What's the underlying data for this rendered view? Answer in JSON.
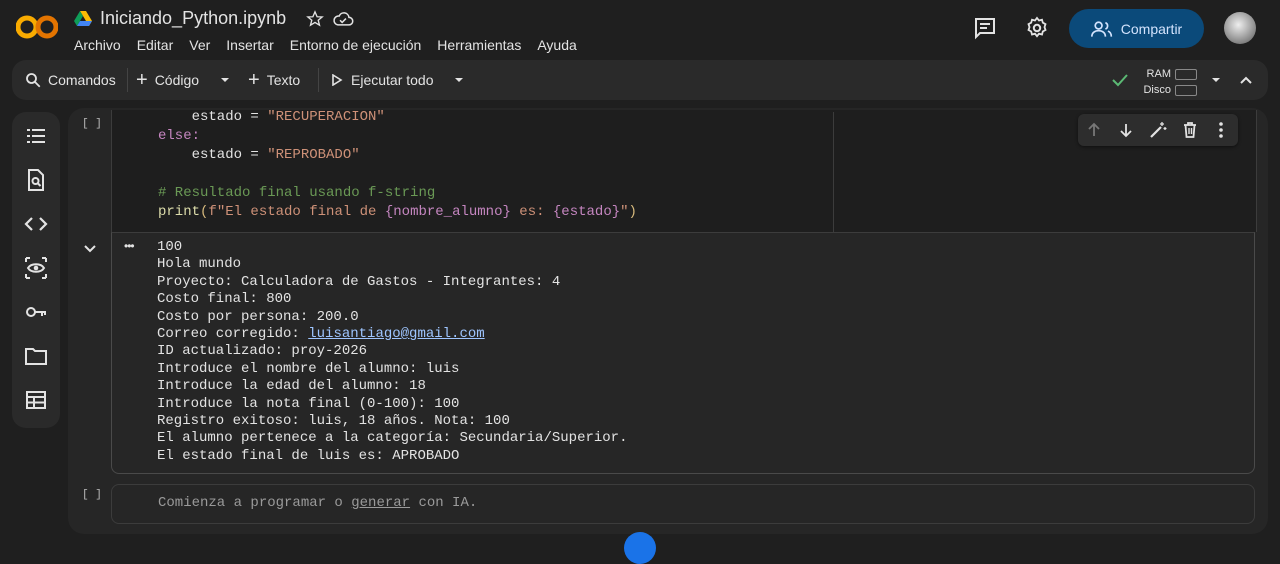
{
  "header": {
    "file_name": "Iniciando_Python.ipynb",
    "menu": [
      "Archivo",
      "Editar",
      "Ver",
      "Insertar",
      "Entorno de ejecución",
      "Herramientas",
      "Ayuda"
    ],
    "share_label": "Compartir"
  },
  "toolbar": {
    "commands_label": "Comandos",
    "code_label": "Código",
    "text_label": "Texto",
    "run_all_label": "Ejecutar todo",
    "ram_label": "RAM",
    "disk_label": "Disco"
  },
  "cell1": {
    "bracket": "[ ]",
    "code_lines": {
      "l1a": "    estado = ",
      "l1b": "\"RECUPERACION\"",
      "l2": "else:",
      "l3a": "    estado = ",
      "l3b": "\"REPROBADO\"",
      "l5": "# Resultado final usando f-string",
      "l6a": "print",
      "l6b": "(",
      "l6c": "f\"El estado final de ",
      "l6d": "{nombre_alumno}",
      "l6e": " es: ",
      "l6f": "{estado}",
      "l6g": "\"",
      "l6h": ")"
    },
    "output_lines": [
      "100",
      "Hola mundo",
      "Proyecto: Calculadora de Gastos - Integrantes: 4",
      "Costo final: 800",
      "Costo por persona: 200.0"
    ],
    "output_email_prefix": "Correo corregido: ",
    "output_email": "luisantiago@gmail.com",
    "output_lines_after": [
      "ID actualizado: proy-2026",
      "Introduce el nombre del alumno: luis",
      "Introduce la edad del alumno: 18",
      "Introduce la nota final (0-100): 100",
      "Registro exitoso: luis, 18 años. Nota: 100",
      "El alumno pertenece a la categoría: Secundaria/Superior.",
      "El estado final de luis es: APROBADO"
    ],
    "output_more": "•••"
  },
  "cell2": {
    "bracket": "[ ]",
    "placeholder_a": "Comienza a programar o ",
    "placeholder_link": "generar",
    "placeholder_b": " con IA."
  },
  "colors": {
    "accent": "#0b4a7a",
    "logo_orange": "#f9ab00",
    "keyword": "#c586c0",
    "string": "#ce9178",
    "comment": "#6a9955"
  }
}
